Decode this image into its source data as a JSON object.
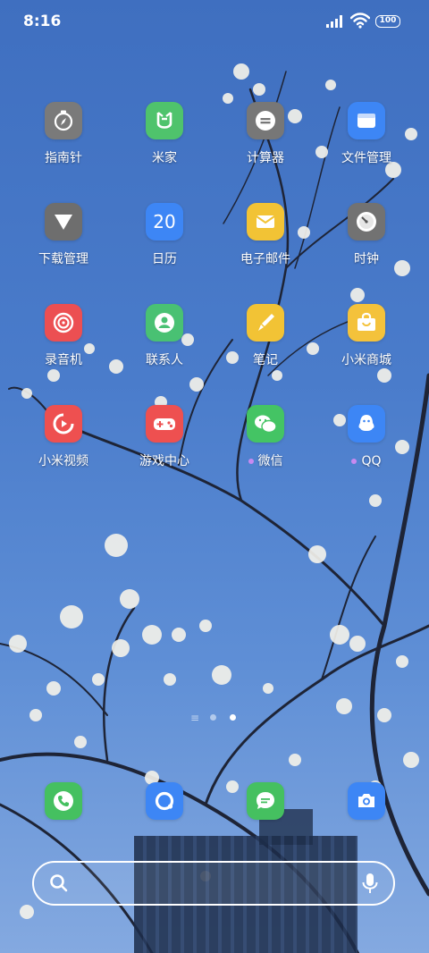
{
  "status_bar": {
    "time": "8:16",
    "battery": "100"
  },
  "apps": [
    {
      "label": "指南针",
      "icon": "compass-icon",
      "color": "#7a7a7a"
    },
    {
      "label": "米家",
      "icon": "mijia-icon",
      "color": "#4fc36c"
    },
    {
      "label": "计算器",
      "icon": "calculator-icon",
      "color": "#777777"
    },
    {
      "label": "文件管理",
      "icon": "file-manager-icon",
      "color": "#3d86f5"
    },
    {
      "label": "下载管理",
      "icon": "download-icon",
      "color": "#6e6e6e"
    },
    {
      "label": "日历",
      "icon": "calendar-icon",
      "color": "#3d86f5",
      "text": "20"
    },
    {
      "label": "电子邮件",
      "icon": "email-icon",
      "color": "#f2c335"
    },
    {
      "label": "时钟",
      "icon": "clock-icon",
      "color": "#727272"
    },
    {
      "label": "录音机",
      "icon": "recorder-icon",
      "color": "#ec4f52"
    },
    {
      "label": "联系人",
      "icon": "contacts-icon",
      "color": "#49c173"
    },
    {
      "label": "笔记",
      "icon": "notes-icon",
      "color": "#f2c335"
    },
    {
      "label": "小米商城",
      "icon": "mi-store-icon",
      "color": "#f4c23b"
    },
    {
      "label": "小米视频",
      "icon": "mi-video-icon",
      "color": "#ee5050"
    },
    {
      "label": "游戏中心",
      "icon": "game-center-icon",
      "color": "#ee5050"
    },
    {
      "label": "微信",
      "icon": "wechat-icon",
      "color": "#44c464"
    },
    {
      "label": "QQ",
      "icon": "qq-icon",
      "color": "#3d86f5"
    }
  ],
  "dock": [
    {
      "icon": "phone-icon",
      "color": "#45c060"
    },
    {
      "icon": "browser-icon",
      "color": "#3d86f5"
    },
    {
      "icon": "messages-icon",
      "color": "#45c060"
    },
    {
      "icon": "camera-icon",
      "color": "#3d86f5"
    }
  ],
  "search": {
    "search_icon": "search-icon",
    "voice_icon": "microphone-icon"
  },
  "page_indicator": {
    "current_page": 2,
    "page_count": 2
  }
}
